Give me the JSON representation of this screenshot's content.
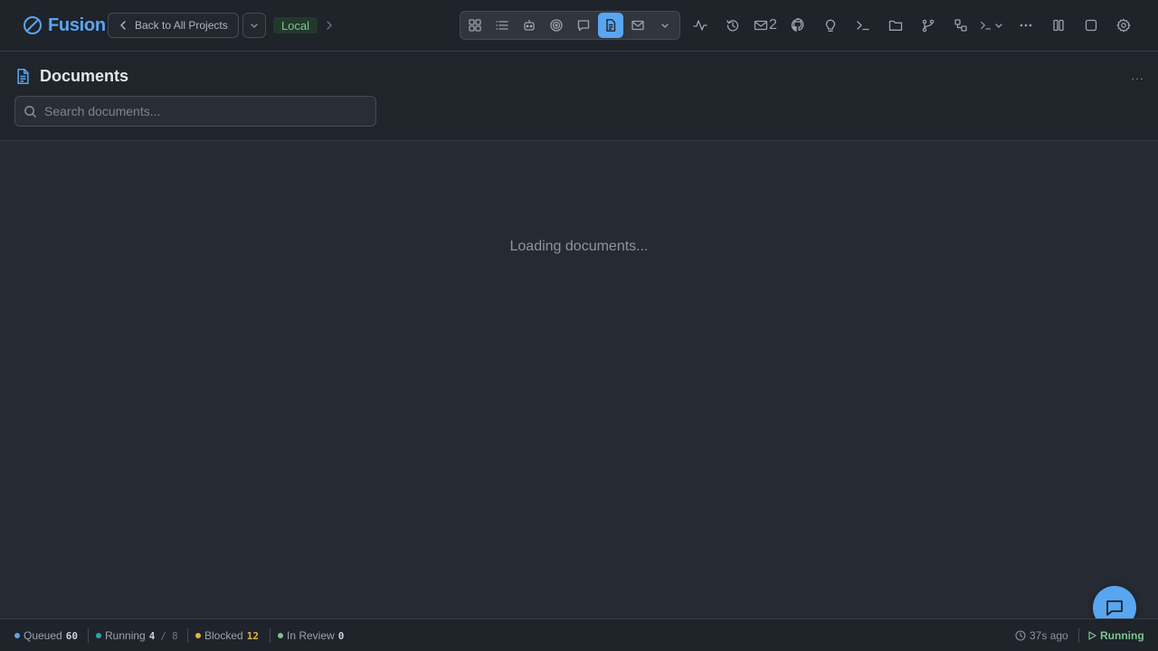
{
  "app": {
    "name": "Fusion"
  },
  "header": {
    "back_label": "Back to All Projects",
    "env_badge": "Local",
    "view_icons": [
      "grid-icon",
      "list-icon",
      "agent-icon",
      "target-icon",
      "chat-icon",
      "document-icon",
      "mail-icon"
    ],
    "active_view": "document-icon",
    "tool_icons": [
      "activity-icon",
      "history-icon",
      "inbox-icon",
      "github-icon",
      "lightbulb-icon",
      "terminal-icon",
      "folder-icon",
      "git-branch-icon",
      "workflow-icon",
      "terminal-dropdown-icon",
      "more-icon",
      "columns-icon",
      "square-icon",
      "settings-icon"
    ],
    "inbox_count": "2"
  },
  "documents": {
    "title": "Documents",
    "more_label": "···",
    "search_placeholder": "Search documents...",
    "search_value": "",
    "loading_text": "Loading documents..."
  },
  "status": {
    "queued_label": "Queued",
    "queued_count": "60",
    "running_label": "Running",
    "running_count": "4",
    "running_sep": "/",
    "running_max": "8",
    "blocked_label": "Blocked",
    "blocked_count": "12",
    "review_label": "In Review",
    "review_count": "0",
    "updated": "37s ago",
    "engine_status": "Running"
  },
  "colors": {
    "accent": "#58a6f0",
    "queued": "#58a6f0",
    "running": "#2aa8a8",
    "blocked": "#e3b341",
    "review": "#7bc592"
  }
}
